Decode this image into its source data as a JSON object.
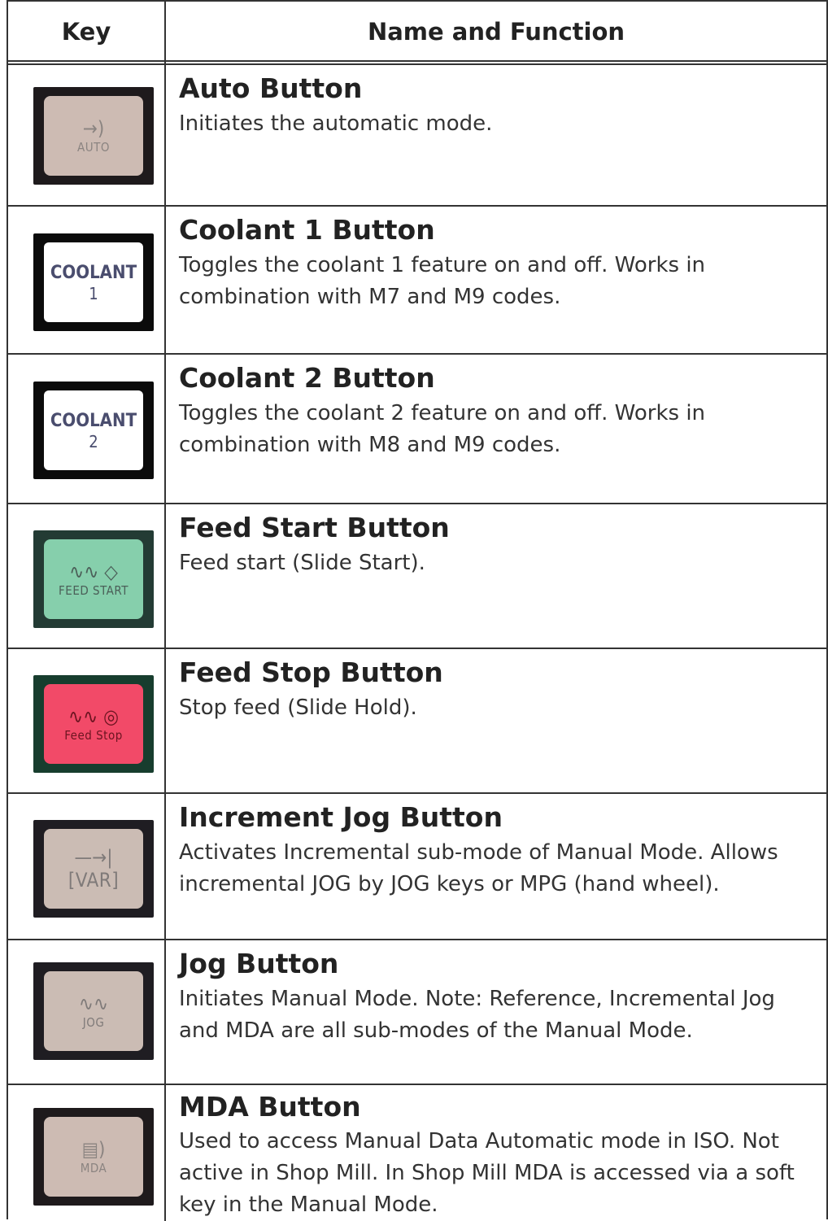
{
  "header": {
    "key": "Key",
    "name": "Name and Function"
  },
  "rows": [
    {
      "key": {
        "glyph": "→)",
        "label": "AUTO",
        "style": "beige"
      },
      "title": "Auto Button",
      "description": "Initiates the automatic mode."
    },
    {
      "key": {
        "line1": "COOLANT",
        "line2": "1",
        "style": "white"
      },
      "title": "Coolant 1 Button",
      "description": "Toggles the coolant 1 feature on and off. Works in combination with M7 and M9 codes."
    },
    {
      "key": {
        "line1": "COOLANT",
        "line2": "2",
        "style": "white"
      },
      "title": "Coolant 2 Button",
      "description": "Toggles the coolant 2 feature on and off. Works in combination with M8 and M9 codes."
    },
    {
      "key": {
        "glyph": "∿∿ ◇",
        "label": "FEED START",
        "style": "green"
      },
      "title": "Feed Start Button",
      "description": "Feed start (Slide Start)."
    },
    {
      "key": {
        "glyph": "∿∿ ◎",
        "label": "Feed Stop",
        "style": "red"
      },
      "title": "Feed Stop Button",
      "description": "Stop feed (Slide Hold)."
    },
    {
      "key": {
        "glyph": "—→|",
        "label": "[VAR]",
        "style": "dark"
      },
      "title": "Increment Jog Button",
      "description": "Activates Incremental sub-mode of Manual Mode. Allows incremental JOG by JOG keys or MPG (hand wheel)."
    },
    {
      "key": {
        "glyph": "∿∿",
        "label": "JOG",
        "style": "dark"
      },
      "title": "Jog Button",
      "description": "Initiates Manual Mode. Note: Reference, Incremental Jog and MDA are all sub-modes of the Manual Mode."
    },
    {
      "key": {
        "glyph": "▤)",
        "label": "MDA",
        "style": "beige"
      },
      "title": "MDA Button",
      "description": "Used to access Manual Data Automatic mode in ISO. Not active in Shop Mill. In Shop Mill MDA is accessed via a soft key in the Manual Mode."
    }
  ]
}
